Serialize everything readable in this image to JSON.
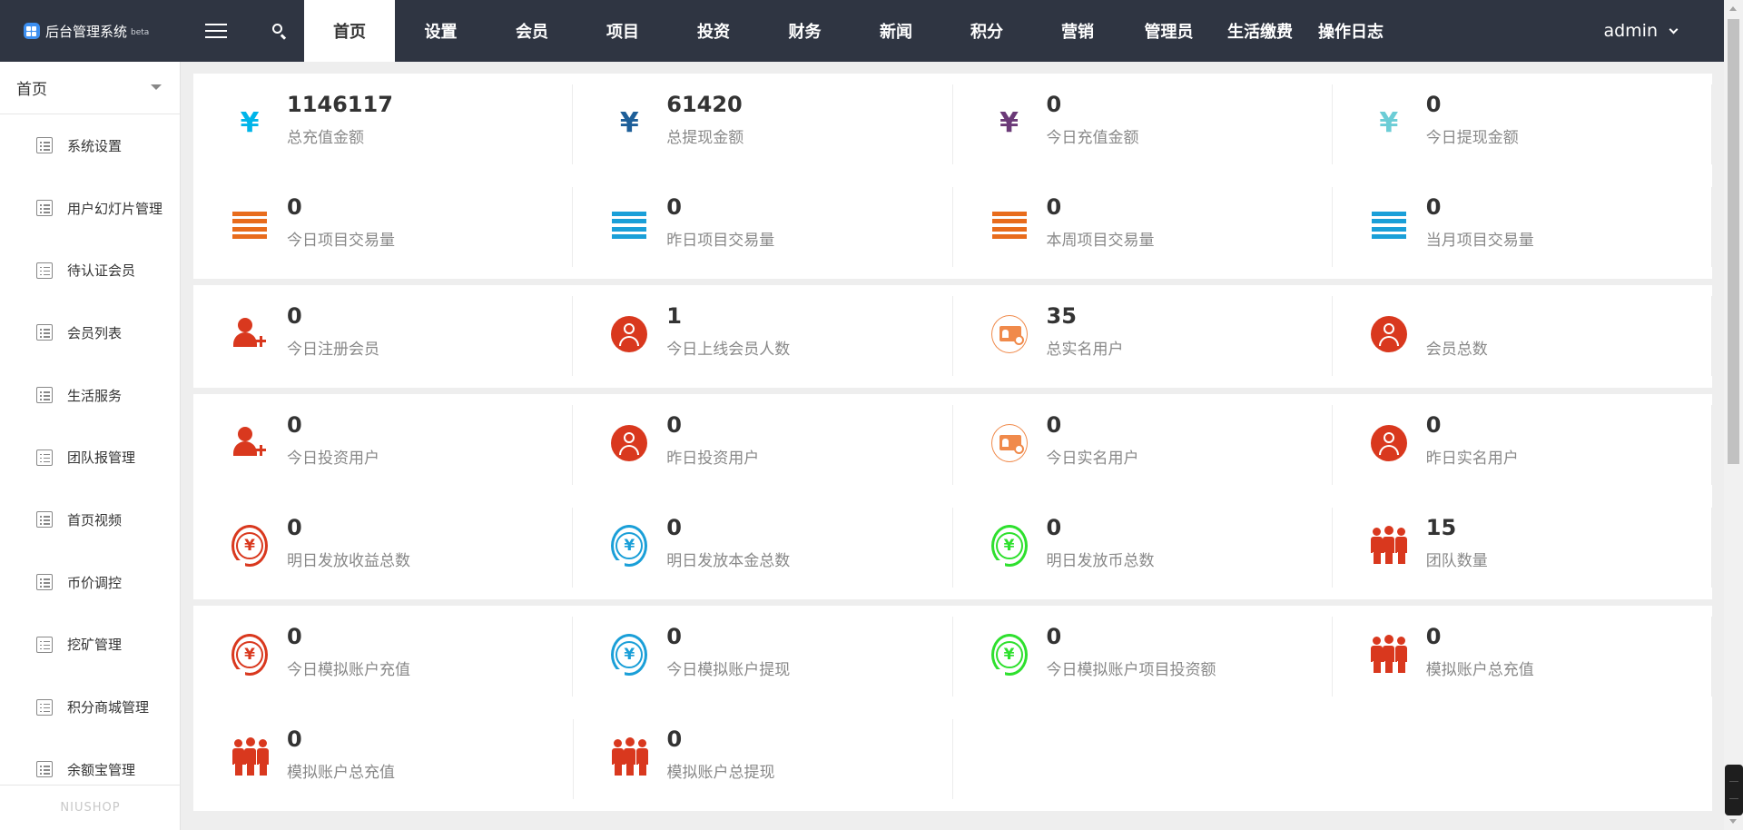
{
  "app": {
    "title": "后台管理系统",
    "beta": "beta"
  },
  "nav": [
    {
      "label": "首页",
      "active": true
    },
    {
      "label": "设置"
    },
    {
      "label": "会员"
    },
    {
      "label": "项目"
    },
    {
      "label": "投资"
    },
    {
      "label": "财务"
    },
    {
      "label": "新闻"
    },
    {
      "label": "积分"
    },
    {
      "label": "营销"
    },
    {
      "label": "管理员"
    },
    {
      "label": "生活缴费"
    },
    {
      "label": "操作日志"
    }
  ],
  "user": {
    "name": "admin"
  },
  "sidebar": {
    "header": "首页",
    "items": [
      {
        "label": "系统设置"
      },
      {
        "label": "用户幻灯片管理"
      },
      {
        "label": "待认证会员"
      },
      {
        "label": "会员列表"
      },
      {
        "label": "生活服务"
      },
      {
        "label": "团队报管理"
      },
      {
        "label": "首页视频"
      },
      {
        "label": "币价调控"
      },
      {
        "label": "挖矿管理"
      },
      {
        "label": "积分商城管理"
      },
      {
        "label": "余额宝管理"
      }
    ],
    "footer": "NIUSHOP"
  },
  "panels": [
    {
      "rows": [
        [
          {
            "value": "1146117",
            "label": "总充值金额",
            "icon": "yen-icon",
            "color": "#00b5e9"
          },
          {
            "value": "61420",
            "label": "总提现金额",
            "icon": "yen-icon",
            "color": "#1e5f99"
          },
          {
            "value": "0",
            "label": "今日充值金额",
            "icon": "yen-icon",
            "color": "#6b3a78"
          },
          {
            "value": "0",
            "label": "今日提现金额",
            "icon": "yen-icon",
            "color": "#6ccdd6"
          }
        ],
        [
          {
            "value": "0",
            "label": "今日项目交易量",
            "icon": "bars-icon",
            "color": "#e86c1c"
          },
          {
            "value": "0",
            "label": "昨日项目交易量",
            "icon": "bars-icon",
            "color": "#1a9fd8"
          },
          {
            "value": "0",
            "label": "本周项目交易量",
            "icon": "bars-icon",
            "color": "#e86c1c"
          },
          {
            "value": "0",
            "label": "当月项目交易量",
            "icon": "bars-icon",
            "color": "#1a9fd8"
          }
        ]
      ]
    },
    {
      "rows": [
        [
          {
            "value": "0",
            "label": "今日注册会员",
            "icon": "add-user-icon",
            "color": "#d9381e"
          },
          {
            "value": "1",
            "label": "今日上线会员人数",
            "icon": "user-circle-icon",
            "color": "#d9381e"
          },
          {
            "value": "35",
            "label": "总实名用户",
            "icon": "id-card-icon",
            "color": "#f08a4b"
          },
          {
            "value": "",
            "label": "会员总数",
            "icon": "user-circle-icon",
            "color": "#d9381e"
          }
        ]
      ]
    },
    {
      "rows": [
        [
          {
            "value": "0",
            "label": "今日投资用户",
            "icon": "add-user-icon",
            "color": "#d9381e"
          },
          {
            "value": "0",
            "label": "昨日投资用户",
            "icon": "user-circle-icon",
            "color": "#d9381e"
          },
          {
            "value": "0",
            "label": "今日实名用户",
            "icon": "id-card-icon",
            "color": "#f08a4b"
          },
          {
            "value": "0",
            "label": "昨日实名用户",
            "icon": "user-circle-icon",
            "color": "#d9381e"
          }
        ],
        [
          {
            "value": "0",
            "label": "明日发放收益总数",
            "icon": "yen-cycle-icon",
            "color": "#d9381e"
          },
          {
            "value": "0",
            "label": "明日发放本金总数",
            "icon": "yen-cycle-icon",
            "color": "#1a9fd8"
          },
          {
            "value": "0",
            "label": "明日发放币总数",
            "icon": "yen-cycle-icon",
            "color": "#2ee02e"
          },
          {
            "value": "15",
            "label": "团队数量",
            "icon": "team-icon",
            "color": "#d9381e"
          }
        ]
      ]
    },
    {
      "rows": [
        [
          {
            "value": "0",
            "label": "今日模拟账户充值",
            "icon": "yen-cycle-icon",
            "color": "#d9381e"
          },
          {
            "value": "0",
            "label": "今日模拟账户提现",
            "icon": "yen-cycle-icon",
            "color": "#1a9fd8"
          },
          {
            "value": "0",
            "label": "今日模拟账户项目投资额",
            "icon": "yen-cycle-icon",
            "color": "#2ee02e"
          },
          {
            "value": "0",
            "label": "模拟账户总充值",
            "icon": "team-icon",
            "color": "#d9381e"
          }
        ],
        [
          {
            "value": "0",
            "label": "模拟账户总充值",
            "icon": "team-icon",
            "color": "#d9381e"
          },
          {
            "value": "0",
            "label": "模拟账户总提现",
            "icon": "team-icon",
            "color": "#d9381e"
          }
        ]
      ]
    }
  ]
}
